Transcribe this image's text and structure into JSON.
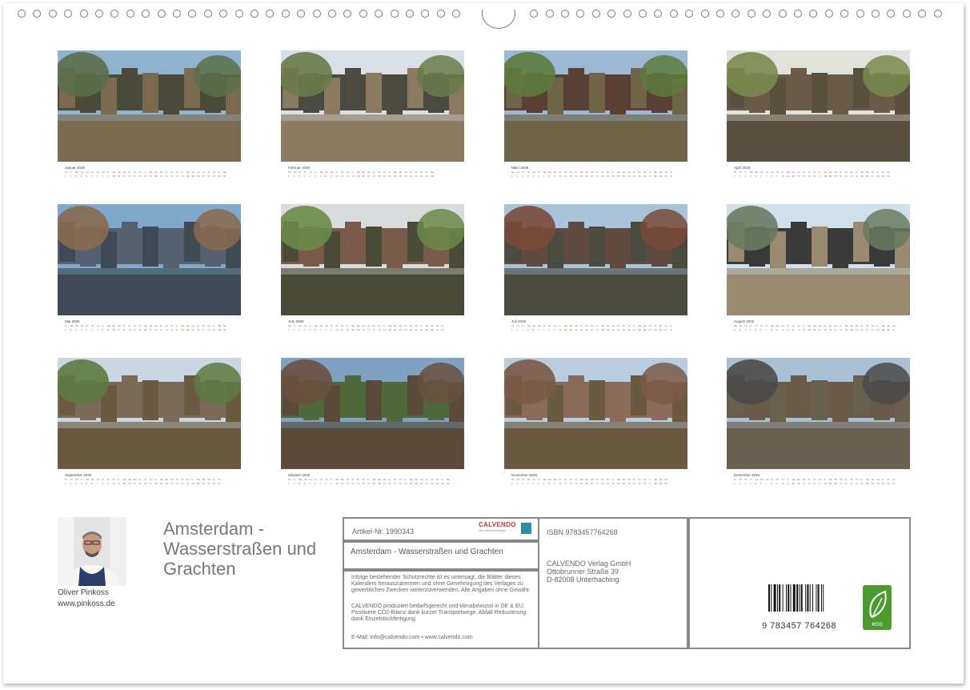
{
  "calendar": {
    "year": "2026",
    "months": [
      {
        "name": "Januar",
        "thumb": "Amsterdam canal with tour boat and houseboats"
      },
      {
        "name": "Februar",
        "thumb": "Canal with parked cars and bridge"
      },
      {
        "name": "März",
        "thumb": "Canal houses with trees"
      },
      {
        "name": "April",
        "thumb": "Canal with cafés and bridge"
      },
      {
        "name": "Mai",
        "thumb": "Wide waterway with Centraal Station"
      },
      {
        "name": "Juni",
        "thumb": "Narrow canal with tree-lined quays"
      },
      {
        "name": "Juli",
        "thumb": "Canal houses reflected in water"
      },
      {
        "name": "August",
        "thumb": "Bicycles at the waterfront"
      },
      {
        "name": "September",
        "thumb": "Canal with boats and trees"
      },
      {
        "name": "Oktober",
        "thumb": "Westerkerk tower by the canal"
      },
      {
        "name": "November",
        "thumb": "Row of canal houses over water"
      },
      {
        "name": "Dezember",
        "thumb": "Canal with bridge and houses"
      }
    ],
    "weekday_labels": [
      "Mo",
      "Di",
      "Mi",
      "Do",
      "Fr",
      "Sa",
      "So"
    ]
  },
  "author": {
    "name": "Oliver Pinkoss",
    "website": "www.pinkoss.de",
    "portrait_icon": "author-portrait"
  },
  "title": "Amsterdam - Wasserstraßen und Grachten",
  "info": {
    "article_no": "Artikel-Nr. 1990343",
    "subtitle": "Amsterdam - Wasserstraßen und Grachten",
    "legal_1": "Infolge bestehender Schutzrechte ist es untersagt, die Blätter dieses Kalenders herauszutrennen und ohne Genehmigung des Verlages zu gewerblichen Zwecken weiterzuverwenden. Alle Angaben ohne Gewähr.",
    "legal_2": "CALVENDO produziert bedarfsgerecht und klimabewusst in DE & EU. Positivere CO2-Bilanz dank kurzer Transportwege. Abfall-Reduzierung dank Einzelstückfertigung.",
    "contact": "E-Mail: info@calvendo.com • www.calvendo.com",
    "isbn": "ISBN 9783457764268",
    "publisher": "CALVENDO Verlag GmbH",
    "street": "Ottobrunner Straße 39",
    "city": "D-82008 Unterhaching",
    "barcode_number": "9 783457 764268",
    "eco_label": "eco"
  },
  "logo": {
    "brand": "CALVENDO",
    "tagline": "Das Kalenderkonzept",
    "brand_color": "#c0392b",
    "mark_color": "#2a8fa6"
  },
  "colors": {
    "weekend_red": "#c0392b",
    "eco_green": "#4d9a2f"
  }
}
